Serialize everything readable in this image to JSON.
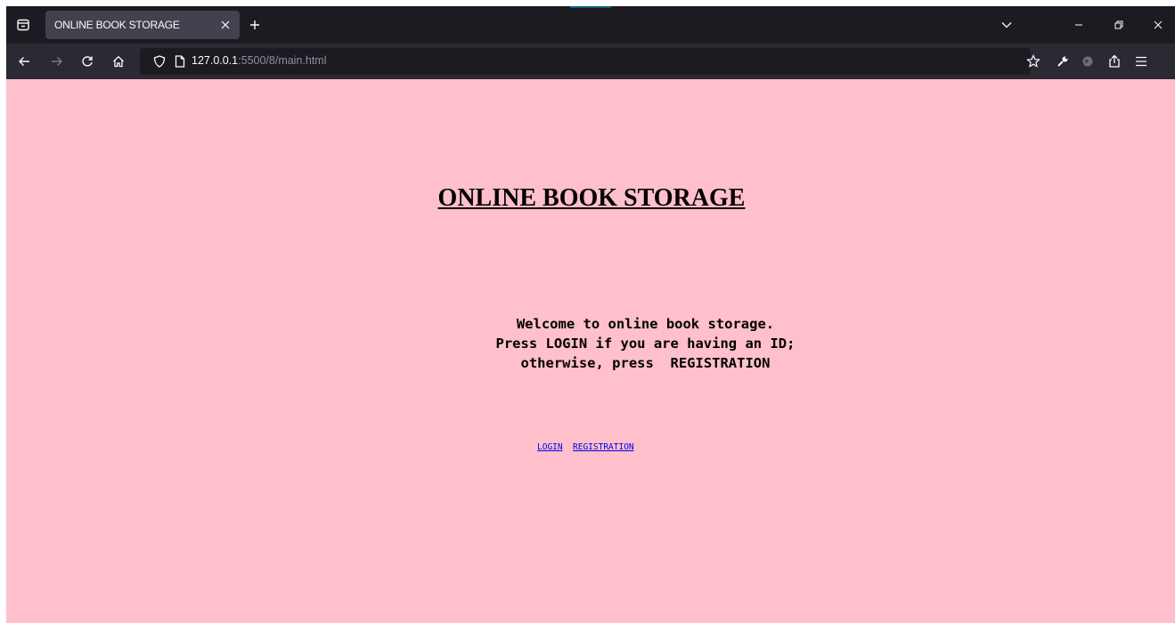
{
  "browser": {
    "tab": {
      "title": "ONLINE BOOK STORAGE",
      "close_icon": "close-icon"
    },
    "new_tab_icon": "plus-icon",
    "url": {
      "host": "127.0.0.1",
      "path": ":5500/8/main.html"
    },
    "colors": {
      "chrome_dark": "#1c1b22",
      "chrome_toolbar": "#2b2a33",
      "tab_active": "#42414d"
    }
  },
  "page": {
    "background": "#ffc0cb",
    "title": "ONLINE BOOK STORAGE",
    "welcome_lines": [
      "Welcome to online book storage.",
      "Press LOGIN if you are having an ID;",
      "otherwise, press  REGISTRATION"
    ],
    "links": {
      "login": "LOGIN",
      "registration": "REGISTRATION"
    },
    "link_color": "#0000ee"
  }
}
